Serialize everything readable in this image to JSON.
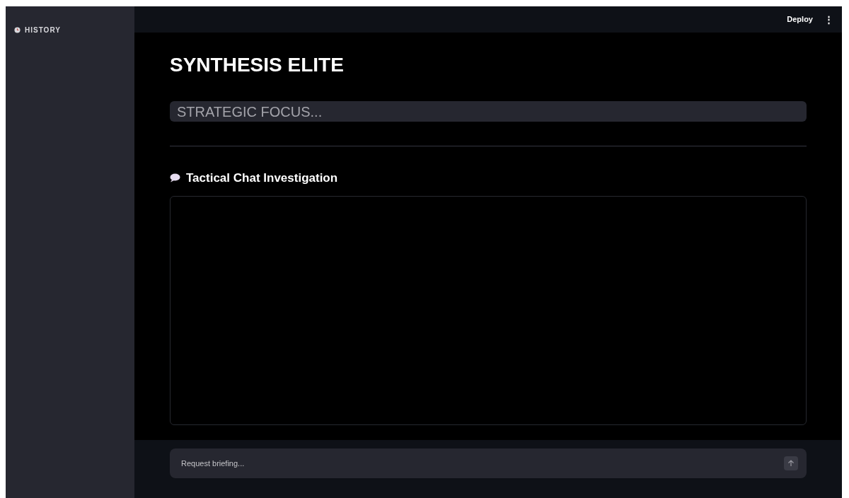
{
  "sidebar": {
    "items": [
      {
        "label": "HISTORY"
      }
    ]
  },
  "header": {
    "deploy": "Deploy",
    "menu": "⋮"
  },
  "title": "SYNTHESIS ELITE",
  "focus_field": {
    "placeholder": "STRATEGIC FOCUS..."
  },
  "chat": {
    "heading": "Tactical Chat Investigation"
  },
  "chat_input": {
    "placeholder": "Request briefing..."
  }
}
